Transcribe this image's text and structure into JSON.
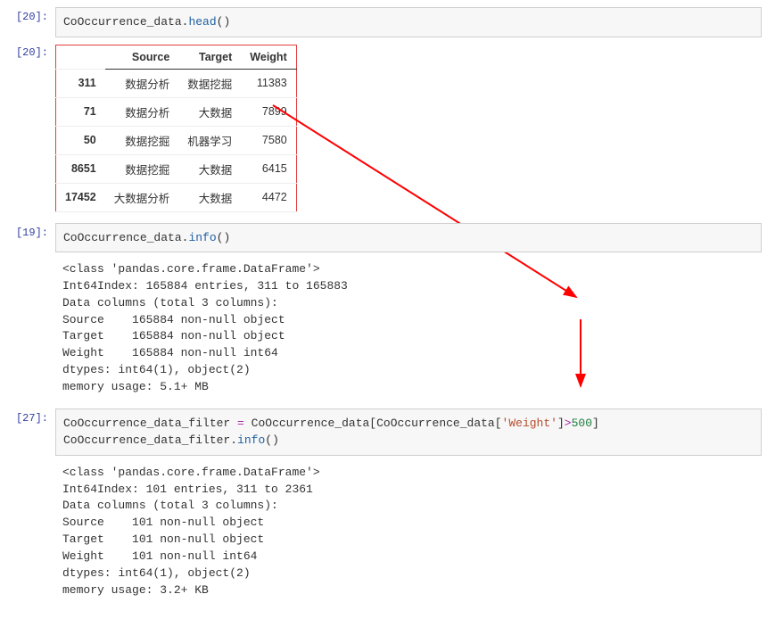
{
  "cells": [
    {
      "prompt_in": "[20]:",
      "prompt_out": "[20]:",
      "code": {
        "var1": "CoOccurrence_data",
        "call": "head",
        "full": "CoOccurrence_data.head()"
      }
    },
    {
      "prompt_in": "[19]:",
      "code": {
        "var1": "CoOccurrence_data",
        "call": "info"
      },
      "output_lines": [
        "<class 'pandas.core.frame.DataFrame'>",
        "Int64Index: 165884 entries, 311 to 165883",
        "Data columns (total 3 columns):",
        "Source    165884 non-null object",
        "Target    165884 non-null object",
        "Weight    165884 non-null int64",
        "dtypes: int64(1), object(2)",
        "memory usage: 5.1+ MB"
      ]
    },
    {
      "prompt_in": "[27]:",
      "code": {
        "lhs": "CoOccurrence_data_filter",
        "rhs_var": "CoOccurrence_data",
        "inner_var": "CoOccurrence_data",
        "key": "'Weight'",
        "cmp": ">",
        "num": "500",
        "line2_var": "CoOccurrence_data_filter",
        "line2_call": "info"
      },
      "output_lines": [
        "<class 'pandas.core.frame.DataFrame'>",
        "Int64Index: 101 entries, 311 to 2361",
        "Data columns (total 3 columns):",
        "Source    101 non-null object",
        "Target    101 non-null object",
        "Weight    101 non-null int64",
        "dtypes: int64(1), object(2)",
        "memory usage: 3.2+ KB"
      ]
    }
  ],
  "table": {
    "columns": [
      "",
      "Source",
      "Target",
      "Weight"
    ],
    "rows": [
      [
        "311",
        "数据分析",
        "数据挖掘",
        "11383"
      ],
      [
        "71",
        "数据分析",
        "大数据",
        "7899"
      ],
      [
        "50",
        "数据挖掘",
        "机器学习",
        "7580"
      ],
      [
        "8651",
        "数据挖掘",
        "大数据",
        "6415"
      ],
      [
        "17452",
        "大数据分析",
        "大数据",
        "4472"
      ]
    ]
  },
  "arrow_color": "#ff0000"
}
